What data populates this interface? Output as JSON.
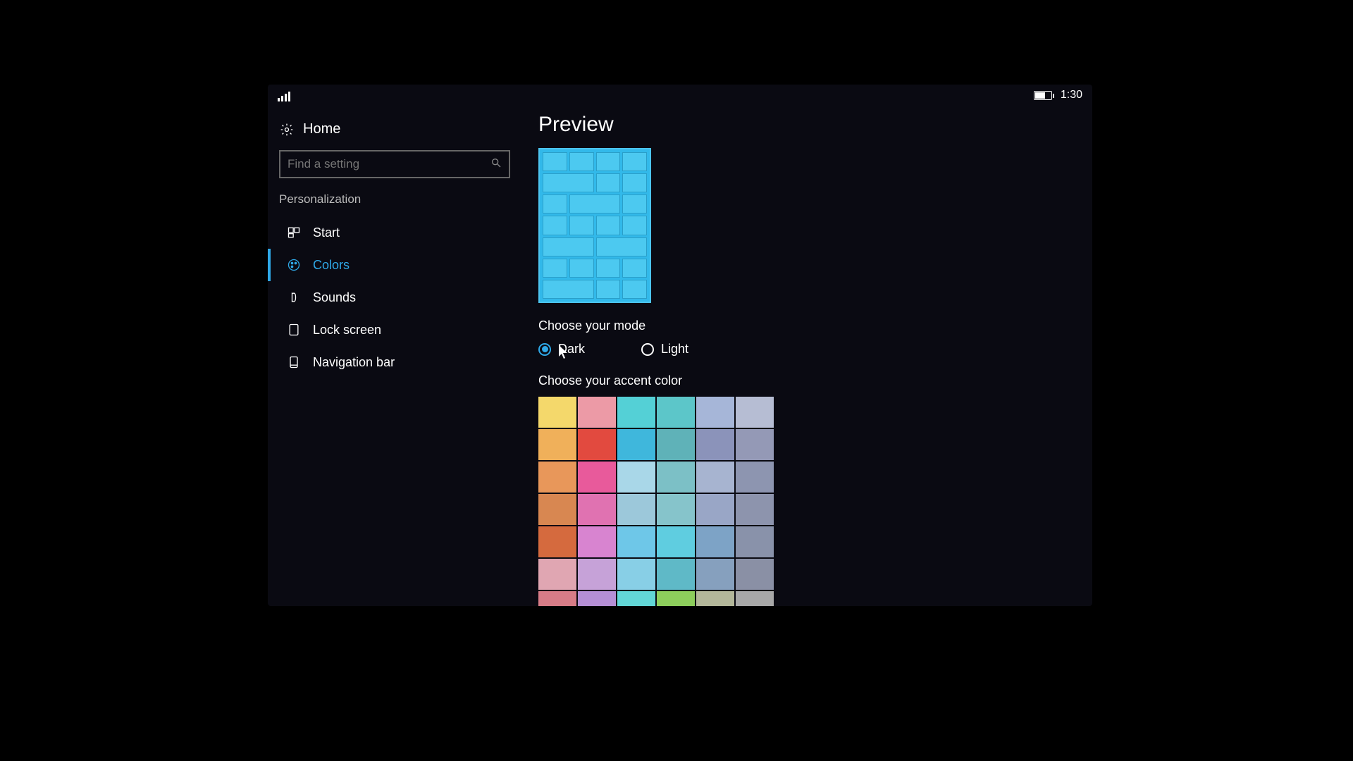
{
  "statusbar": {
    "time": "1:30"
  },
  "home_label": "Home",
  "search": {
    "placeholder": "Find a setting"
  },
  "section": "Personalization",
  "nav": [
    {
      "label": "Start"
    },
    {
      "label": "Colors"
    },
    {
      "label": "Sounds"
    },
    {
      "label": "Lock screen"
    },
    {
      "label": "Navigation bar"
    }
  ],
  "active_nav_index": 1,
  "main": {
    "preview_title": "Preview",
    "mode_title": "Choose your mode",
    "mode_options": {
      "dark": "Dark",
      "light": "Light"
    },
    "selected_mode": "dark",
    "accent_title": "Choose your accent color",
    "accent_colors": [
      "#f4d86b",
      "#ec9aa6",
      "#54d0d6",
      "#5cc6c9",
      "#a6b6d8",
      "#b6bdd3",
      "#f0b05a",
      "#e24a3f",
      "#3fb7dc",
      "#5fb2b8",
      "#8b93ba",
      "#9499b6",
      "#e8975a",
      "#e85a9b",
      "#a9d7e8",
      "#7cc0c6",
      "#a7b4d0",
      "#8d95b0",
      "#d88751",
      "#e072b1",
      "#9cc8da",
      "#86c4cb",
      "#99a6c6",
      "#8d94ad",
      "#d56a3e",
      "#d884d0",
      "#6ec7e8",
      "#5fcde0",
      "#7da3c6",
      "#8992aa",
      "#e0a6b2",
      "#c6a2d8",
      "#88cfe6",
      "#5fb9c7",
      "#86a0be",
      "#8a90a5",
      "#d77c87",
      "#b58fd5",
      "#62d6d6",
      "#8dce5c",
      "#b3b79a",
      "#a8a8a8"
    ]
  }
}
